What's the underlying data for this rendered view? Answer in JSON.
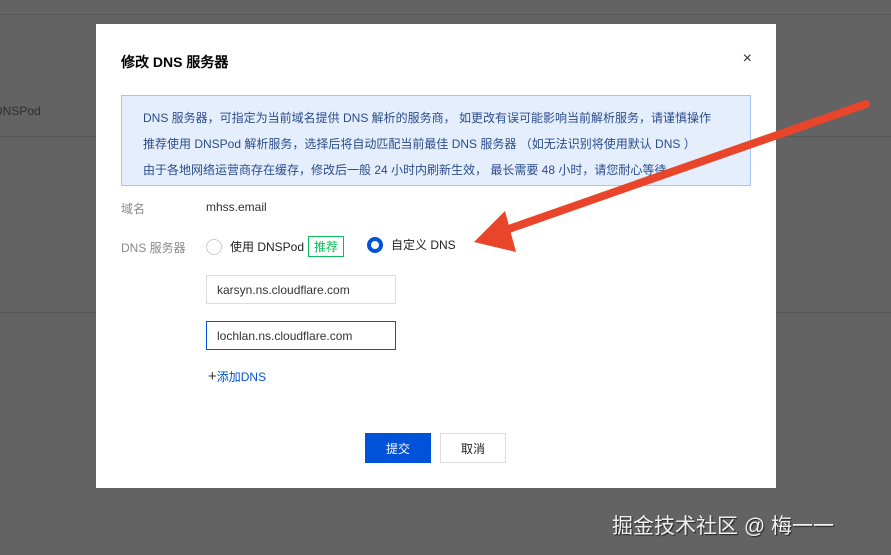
{
  "background": {
    "partial_text": "DNSPod"
  },
  "modal": {
    "title": "修改 DNS 服务器",
    "close_icon": "×",
    "info_lines": [
      "DNS 服务器，可指定为当前域名提供 DNS 解析的服务商， 如更改有误可能影响当前解析服务，请谨慎操作",
      "推荐使用 DNSPod 解析服务，选择后将自动匹配当前最佳 DNS 服务器 （如无法识别将使用默认 DNS ）",
      "由于各地网络运营商存在缓存，修改后一般 24 小时内刷新生效， 最长需要 48 小时，请您耐心等待"
    ],
    "domain_label": "域名",
    "domain_value": "mhss.email",
    "dns_label": "DNS 服务器",
    "option_dnspod": "使用 DNSPod",
    "option_dnspod_tag": "推荐",
    "option_custom": "自定义 DNS",
    "selected_option": "自定义 DNS",
    "dns_servers": [
      "karsyn.ns.cloudflare.com",
      "lochlan.ns.cloudflare.com"
    ],
    "add_plus": "+",
    "add_label": "添加DNS",
    "submit": "提交",
    "cancel": "取消"
  },
  "watermark": "掘金技术社区 @ 梅一一",
  "colors": {
    "primary": "#0052d9",
    "tag": "#0abf5b",
    "arrow": "#e8452a"
  }
}
